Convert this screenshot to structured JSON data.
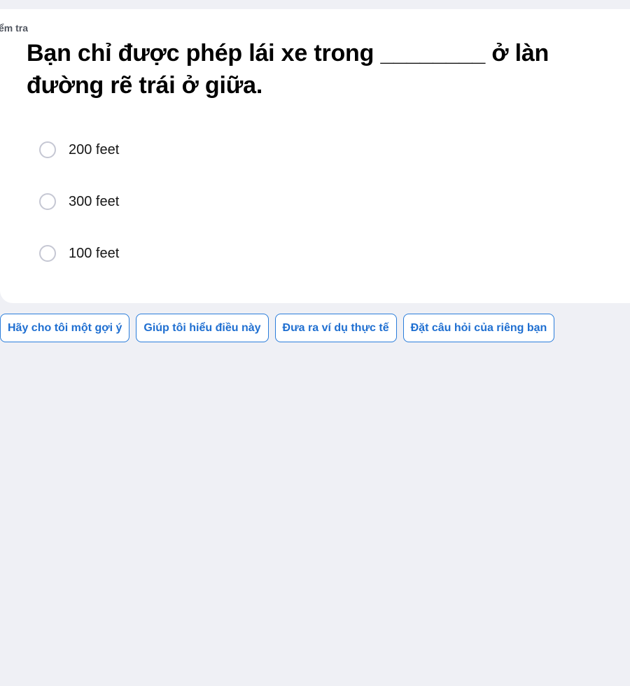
{
  "quiz": {
    "tag_label": "Kiểm tra",
    "question": "Bạn chỉ được phép lái xe trong ________ ở làn đường rẽ trái ở giữa.",
    "options": [
      {
        "label": "200 feet"
      },
      {
        "label": "300 feet"
      },
      {
        "label": "100 feet"
      }
    ]
  },
  "actions": [
    {
      "label": "Hãy cho tôi một gợi ý"
    },
    {
      "label": "Giúp tôi hiểu điều này"
    },
    {
      "label": "Đưa ra ví dụ thực tế"
    },
    {
      "label": "Đặt câu hỏi của riêng bạn"
    }
  ],
  "colors": {
    "accent": "#1f6fd1",
    "background": "#eff0f5",
    "card": "#ffffff"
  }
}
